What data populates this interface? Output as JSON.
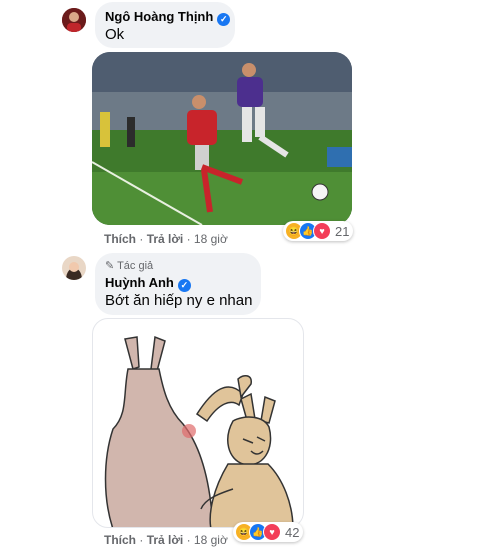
{
  "comment1": {
    "author": "Ngô Hoàng Thịnh",
    "text": "Ok",
    "actions": {
      "like": "Thích",
      "reply": "Trả lời",
      "time": "18 giờ"
    },
    "reactions": {
      "icons": [
        "haha-icon",
        "like-icon",
        "love-icon"
      ],
      "count": "21"
    }
  },
  "comment2": {
    "author_badge": "Tác giả",
    "author": "Huỳnh Anh",
    "text": "Bớt ăn hiếp ny e nhan",
    "actions": {
      "like": "Thích",
      "reply": "Trả lời",
      "time": "18 giờ"
    },
    "reactions": {
      "icons": [
        "haha-icon",
        "like-icon",
        "love-icon"
      ],
      "count": "42"
    }
  },
  "colors": {
    "like": "#1877f2",
    "love": "#f33e58",
    "haha": "#f7b125",
    "muted": "#65676b",
    "bubble": "#f0f2f5"
  }
}
